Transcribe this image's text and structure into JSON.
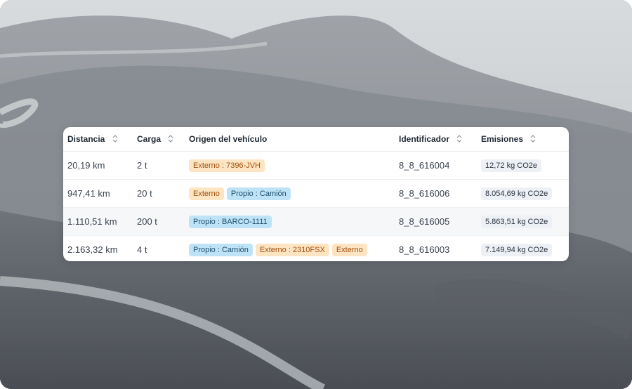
{
  "table": {
    "headers": {
      "distance": "Distancia",
      "load": "Carga",
      "origin": "Origen del vehículo",
      "identifier": "Identificador",
      "emissions": "Emisiones"
    },
    "rows": [
      {
        "distance": "20,19 km",
        "load": "2 t",
        "origin_tags": [
          {
            "type": "external",
            "text": "Externo : 7396-JVH"
          }
        ],
        "identifier": "8_8_616004",
        "emissions": "12,72 kg CO2e"
      },
      {
        "distance": "947,41 km",
        "load": "20 t",
        "origin_tags": [
          {
            "type": "external",
            "text": "Externo"
          },
          {
            "type": "own",
            "text": "Propio : Camión"
          }
        ],
        "identifier": "8_8_616006",
        "emissions": "8.054,69 kg CO2e"
      },
      {
        "distance": "1.110,51 km",
        "load": "200 t",
        "origin_tags": [
          {
            "type": "own",
            "text": "Propio : BARCO-1111"
          }
        ],
        "identifier": "8_8_616005",
        "emissions": "5.863,51 kg CO2e"
      },
      {
        "distance": "2.163,32 km",
        "load": "4 t",
        "origin_tags": [
          {
            "type": "own",
            "text": "Propio : Camión"
          },
          {
            "type": "external",
            "text": "Externo : 2310FSX"
          },
          {
            "type": "external",
            "text": "Externo"
          }
        ],
        "identifier": "8_8_616003",
        "emissions": "7.149,94 kg CO2e"
      }
    ]
  },
  "icons": {
    "sort": "sort-icon"
  },
  "colors": {
    "external_tag_bg": "#fde4c2",
    "external_tag_text": "#a4510f",
    "own_tag_bg": "#bfe3f6",
    "own_tag_text": "#1d4f6e",
    "emissions_badge_bg": "#edf0f4"
  }
}
